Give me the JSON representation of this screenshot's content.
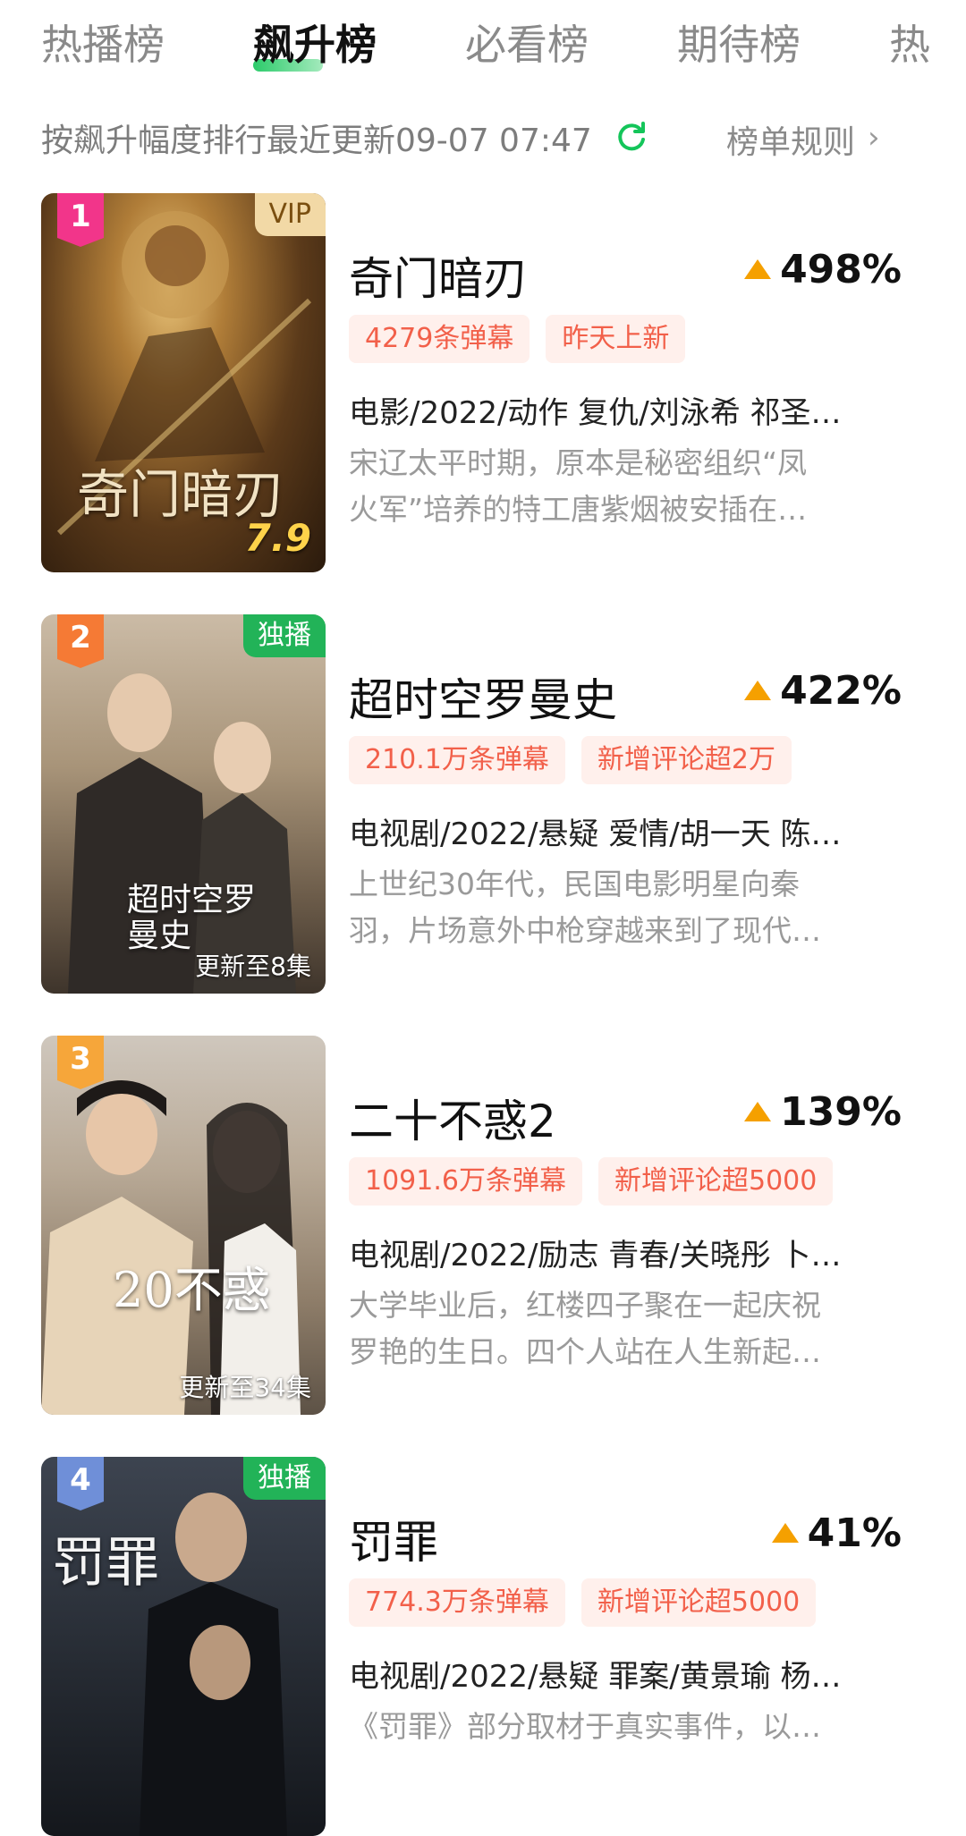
{
  "tabs": [
    {
      "label": "热播榜"
    },
    {
      "label": "飙升榜"
    },
    {
      "label": "必看榜"
    },
    {
      "label": "期待榜"
    },
    {
      "label": "热"
    }
  ],
  "active_tab": "飙升榜",
  "subbar": {
    "sort_text": "按飙升幅度排行最近更新09-07 07:47",
    "rules_label": "榜单规则",
    "rules_chevron": "›"
  },
  "colors": {
    "accent_green": "#14c55a",
    "tag_bg": "#fff0ec",
    "tag_text": "#f2604a",
    "rise_arrow": "#f5a000",
    "rank1": "#f2358a",
    "rank2": "#f57a35",
    "rank3": "#f6a63a",
    "rank4": "#6f8fd8"
  },
  "items": [
    {
      "rank": "1",
      "corner": "VIP",
      "poster_title": "奇门暗刃",
      "poster_score": "7.9",
      "poster_sub": "",
      "title": "奇门暗刃",
      "rise": "498%",
      "tags": [
        "4279条弹幕",
        "昨天上新"
      ],
      "meta": "电影/2022/动作 复仇/刘泳希 祁圣…",
      "desc": [
        "宋辽太平时期，原本是秘密组织“凤",
        "火军”培养的特工唐紫烟被安插在…"
      ]
    },
    {
      "rank": "2",
      "corner": "独播",
      "poster_title": "超时空罗曼史",
      "poster_score": "",
      "poster_sub": "更新至8集",
      "title": "超时空罗曼史",
      "rise": "422%",
      "tags": [
        "210.1万条弹幕",
        "新增评论超2万"
      ],
      "meta": "电视剧/2022/悬疑 爱情/胡一天 陈…",
      "desc": [
        "上世纪30年代，民国电影明星向秦",
        "羽，片场意外中枪穿越来到了现代…"
      ]
    },
    {
      "rank": "3",
      "corner": "",
      "poster_title": "20不惑",
      "poster_score": "",
      "poster_sub": "更新至34集",
      "title": "二十不惑2",
      "rise": "139%",
      "tags": [
        "1091.6万条弹幕",
        "新增评论超5000"
      ],
      "meta": "电视剧/2022/励志 青春/关晓彤 卜…",
      "desc": [
        "大学毕业后，红楼四子聚在一起庆祝",
        "罗艳的生日。四个人站在人生新起…"
      ]
    },
    {
      "rank": "4",
      "corner": "独播",
      "poster_title": "罚罪",
      "poster_score": "",
      "poster_sub": "",
      "title": "罚罪",
      "rise": "41%",
      "tags": [
        "774.3万条弹幕",
        "新增评论超5000"
      ],
      "meta": "电视剧/2022/悬疑 罪案/黄景瑜 杨…",
      "desc": [
        "《罚罪》部分取材于真实事件，以…"
      ]
    }
  ]
}
